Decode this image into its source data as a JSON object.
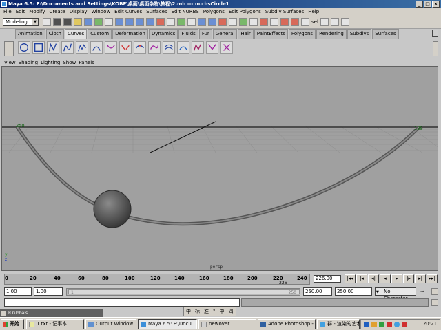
{
  "window": {
    "title": "Maya 6.5: F:\\Documents and Settings\\KOBE\\桌面\\桌面杂物\\教程\\2.mb   ---   nurbsCircle1",
    "buttons": [
      "_",
      "□",
      "×"
    ]
  },
  "menubar": [
    "File",
    "Edit",
    "Modify",
    "Create",
    "Display",
    "Window",
    "Edit Curves",
    "Surfaces",
    "Edit NURBS",
    "Polygons",
    "Edit Polygons",
    "Subdiv Surfaces",
    "Help"
  ],
  "toolbar": {
    "mode": "Modeling",
    "status_label": "sel"
  },
  "shelf_tabs": [
    "Animation",
    "Cloth",
    "Curves",
    "Custom",
    "Deformation",
    "Dynamics",
    "Fluids",
    "Fur",
    "General",
    "Hair",
    "PaintEffects",
    "Polygons",
    "Rendering",
    "Subdivs",
    "Surfaces"
  ],
  "active_shelf_tab": "Curves",
  "panel_menu": [
    "View",
    "Shading",
    "Lighting",
    "Show",
    "Panels"
  ],
  "viewport": {
    "camera": "persp",
    "point_label_left": "250",
    "point_label_right": "180",
    "axis_y": "y",
    "axis_z": "z"
  },
  "timeline": {
    "ticks": [
      "0",
      "20",
      "40",
      "60",
      "80",
      "100",
      "120",
      "140",
      "160",
      "180",
      "200",
      "220",
      "240"
    ],
    "current_marker": "226",
    "current_time": "226.00",
    "playback_buttons": [
      "|◂◂",
      "|◂",
      "◂|",
      "◂",
      "▸",
      "|▸",
      "▸|",
      "▸▸|"
    ]
  },
  "range": {
    "start_time": "1.00",
    "playback_start": "1.00",
    "playback_end": "250.00",
    "end_time": "250.00",
    "bar_start": "1",
    "bar_end": "250",
    "character_set": "No Character Set"
  },
  "ime": [
    "中",
    "标",
    "准",
    "°",
    "中",
    "四"
  ],
  "rglobals": "R.Globals",
  "taskbar": {
    "start": "开始",
    "tasks": [
      {
        "label": "1.txt - 记事本"
      },
      {
        "label": "Output Window"
      },
      {
        "label": "Maya 6.5: F:\\Docu..."
      },
      {
        "label": "newover"
      },
      {
        "label": "Adobe Photoshop -..."
      },
      {
        "label": "群 - 渲染的艺术"
      }
    ],
    "clock": "20:21"
  }
}
